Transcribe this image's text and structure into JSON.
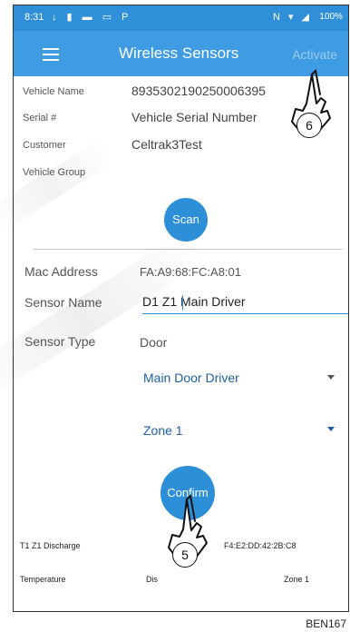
{
  "statusbar": {
    "time": "8:31",
    "left_icons": "↓ ▮ ▬ ▭ P",
    "right_icons": "N ▾ ◢",
    "battery": "100%"
  },
  "appbar": {
    "title": "Wireless Sensors",
    "activate_label": "Activate",
    "menu_icon": "hamburger-icon"
  },
  "vehicle": {
    "name_label": "Vehicle Name",
    "name_value": "8935302190250006395",
    "serial_label": "Serial #",
    "serial_value": "Vehicle Serial Number",
    "customer_label": "Customer",
    "customer_value": "Celtrak3Test",
    "group_label": "Vehicle Group"
  },
  "scan_label": "Scan",
  "sensor": {
    "mac_label": "Mac Address",
    "mac_value": "FA:A9:68:FC:A8:01",
    "name_label": "Sensor Name",
    "name_value": "D1 Z1 Main Driver",
    "type_label": "Sensor Type",
    "type_value": "Door",
    "position_select": "Main Door Driver",
    "zone_select": "Zone 1"
  },
  "confirm_label": "Confirm",
  "bottom_row": {
    "r1c1": "T1 Z1 Discharge",
    "r1c2": "F4:E2:DD:42:2B:C8",
    "r2c1": "Temperature",
    "r2c2": "Dis",
    "r2c3": "Zone 1"
  },
  "callouts": {
    "six": "6",
    "five": "5"
  },
  "doc_code": "BEN167",
  "colors": {
    "primary": "#2e8fd9",
    "appbar": "#3f9be2",
    "link": "#1f5fa8"
  }
}
